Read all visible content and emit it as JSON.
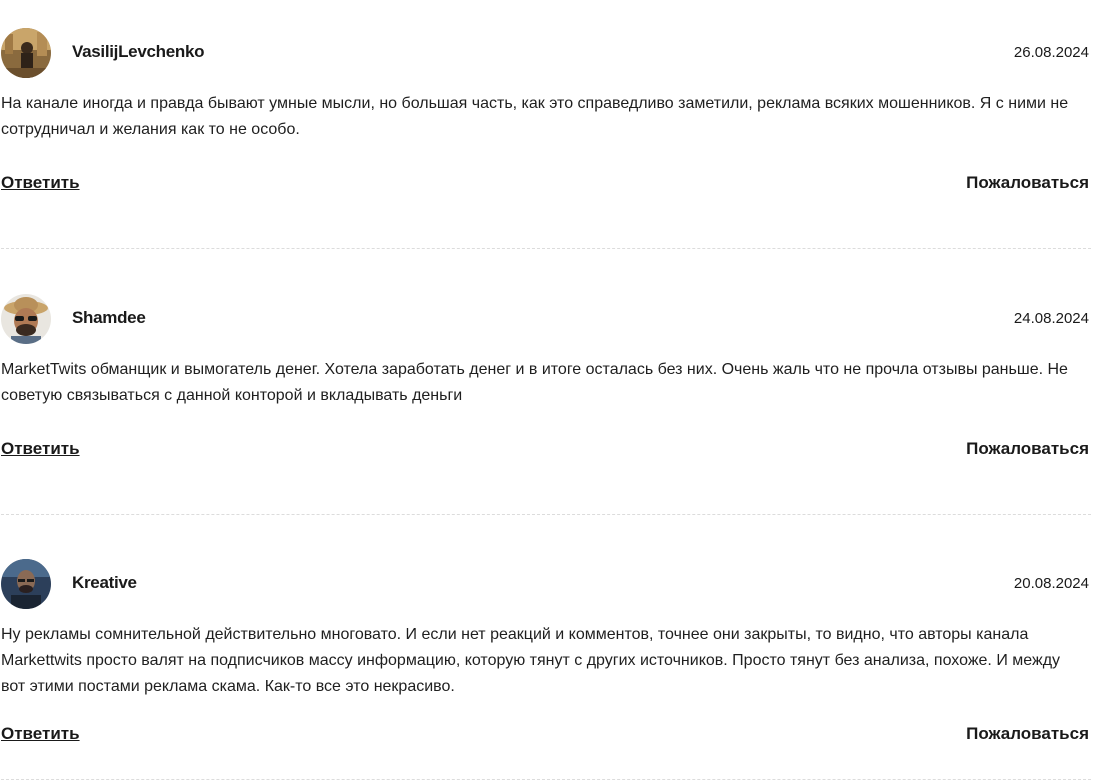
{
  "comments": [
    {
      "author": "VasilijLevchenko",
      "date": "26.08.2024",
      "text": "На канале иногда и правда бывают умные мысли, но большая часть, как это справедливо заметили, реклама всяких мошенников. Я с ними не сотрудничал и желания как то не особо.",
      "reply_label": "Ответить",
      "report_label": "Пожаловаться"
    },
    {
      "author": "Shamdee",
      "date": "24.08.2024",
      "text": "MarketTwits обманщик и вымогатель денег. Хотела заработать денег и в итоге осталась без них. Очень жаль что не прочла отзывы раньше. Не советую связываться с данной конторой и вкладывать деньги",
      "reply_label": "Ответить",
      "report_label": "Пожаловаться"
    },
    {
      "author": "Kreative",
      "date": "20.08.2024",
      "text": "Ну рекламы сомнительной действительно многовато. И если нет реакций и комментов, точнее они закрыты, то видно, что авторы канала Markettwits просто валят на подписчиков массу информацию, которую тянут с других источников. Просто тянут без анализа, похоже. И между вот этими постами реклама скама. Как-то все это некрасиво.",
      "reply_label": "Ответить",
      "report_label": "Пожаловаться"
    }
  ]
}
